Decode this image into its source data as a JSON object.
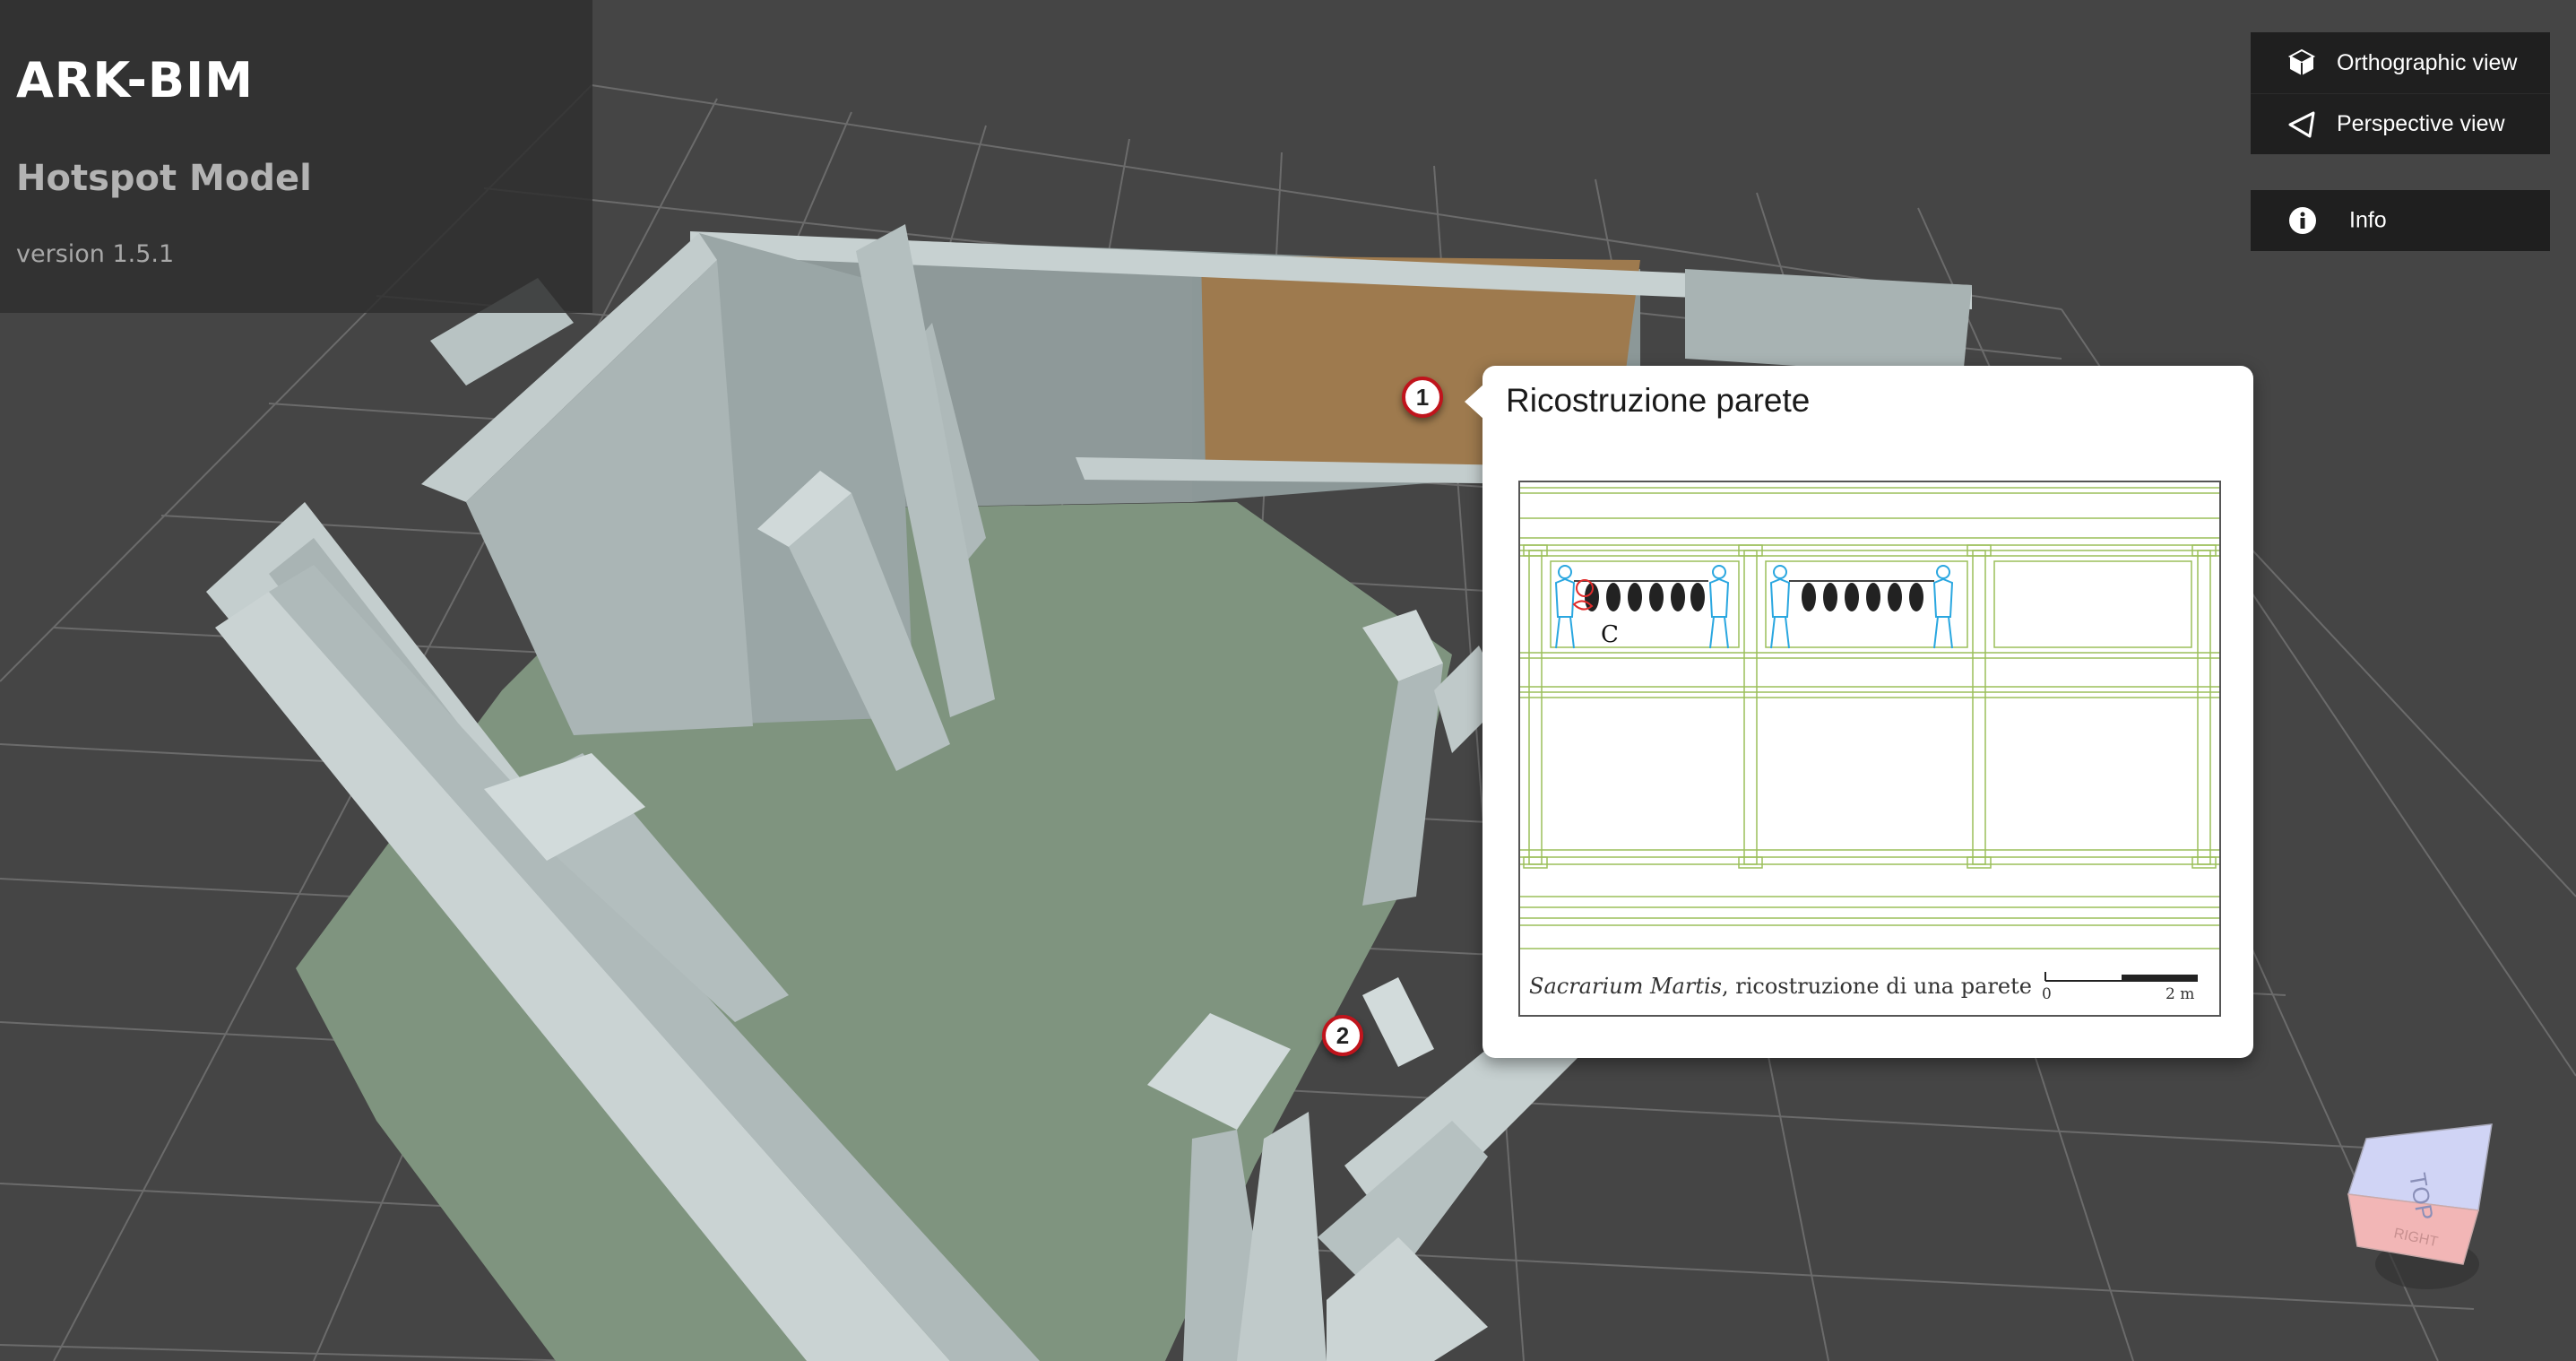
{
  "header": {
    "app_name": "ARK-BIM",
    "subtitle": "Hotspot Model",
    "version": "version 1.5.1"
  },
  "view_controls": {
    "orthographic_label": "Orthographic view",
    "perspective_label": "Perspective view",
    "info_label": "Info"
  },
  "hotspots": [
    {
      "number": "1"
    },
    {
      "number": "2"
    }
  ],
  "popup": {
    "title": "Ricostruzione parete",
    "figure": {
      "label_c": "C",
      "caption_italic": "Sacrarium Martis",
      "caption_rest": ", ricostruzione di una parete",
      "scale_start": "0",
      "scale_end": "2 m"
    }
  },
  "navcube": {
    "top_label": "TOP",
    "side_label": "RIGHT"
  },
  "colors": {
    "background": "#454545",
    "floor": "#7f947f",
    "wall": "#b8c4c4",
    "highlight_wall": "#9e7a4e",
    "hotspot_ring": "#c0141c",
    "drawing_green": "#9bbf5a",
    "drawing_cyan": "#2aa7e0"
  }
}
